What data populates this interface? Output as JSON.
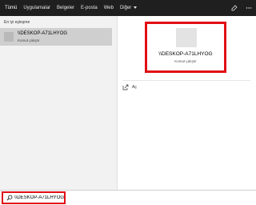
{
  "topbar": {
    "tabs": [
      {
        "label": "Tümü"
      },
      {
        "label": "Uygulamalar"
      },
      {
        "label": "Belgeler"
      },
      {
        "label": "E-posta"
      },
      {
        "label": "Web"
      },
      {
        "label": "Diğer"
      }
    ],
    "icons": [
      "feedback-icon",
      "more-icon"
    ]
  },
  "left_panel": {
    "section_label": "En iyi eşleşme",
    "best_match": {
      "title": "\\\\DESKOP-A71LHYOG",
      "subtitle": "Komut çalıştır"
    }
  },
  "preview": {
    "title": "\\\\DESKOP-A71LHYOG",
    "subtitle": "Komut çalıştır",
    "actions": [
      {
        "label": "Aç",
        "icon": "open-icon"
      }
    ]
  },
  "search": {
    "value": "\\\\DESKOP-A71LHYOG",
    "icon": "search-icon"
  },
  "colors": {
    "highlight": "#e10f14",
    "topbar_bg": "#1f1f1f",
    "selected_row": "#cfcfcf"
  }
}
